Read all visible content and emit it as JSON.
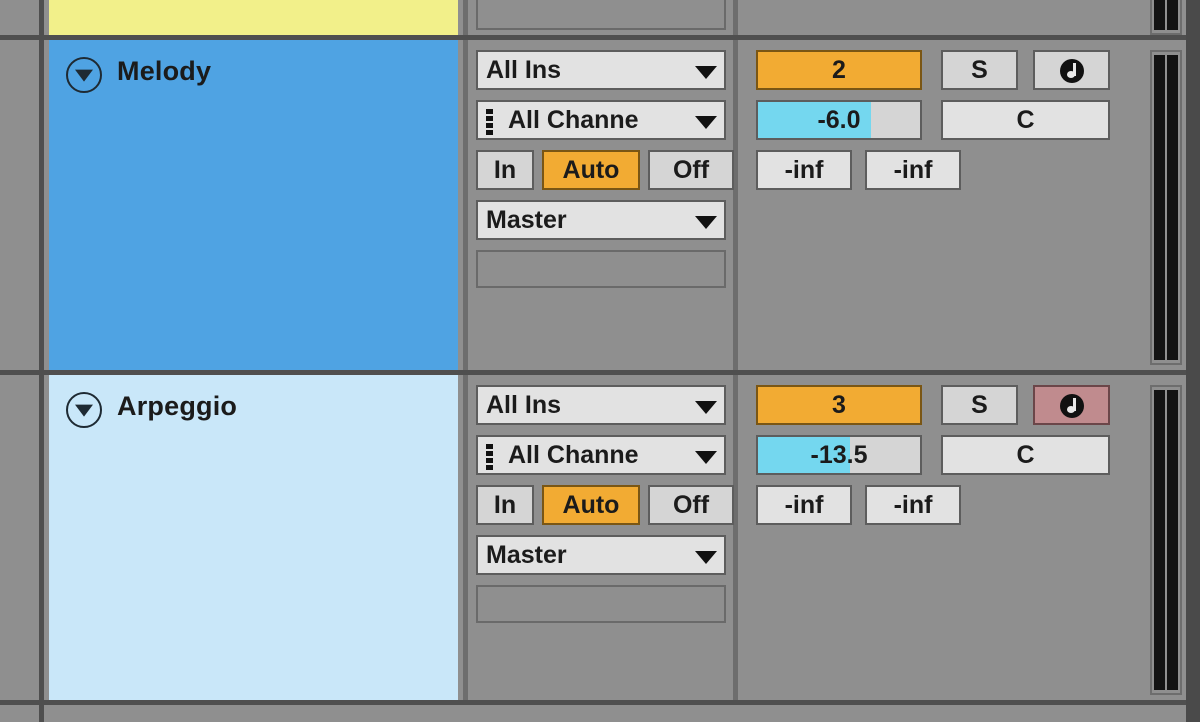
{
  "window": {
    "title": "Ableton Live - Session View Track Headers"
  },
  "tracks": [
    {
      "name": "",
      "color": "#f2f08a",
      "partial": true,
      "io": {
        "empty_slot": true
      }
    },
    {
      "name": "Melody",
      "color": "#4fa3e3",
      "fold_icon": "chevron-down-circle-icon",
      "io": {
        "input_type": "All Ins",
        "input_channel": "All Channe",
        "monitor": {
          "in": "In",
          "auto": "Auto",
          "off": "Off",
          "selected": "Auto"
        },
        "output_type": "Master",
        "output_channel": ""
      },
      "mixer": {
        "track_number": "2",
        "solo": "S",
        "arm_icon": "record-arm-midi-icon",
        "armed": false,
        "volume": "-6.0",
        "volume_fill_pct": 70,
        "pan": "C",
        "send_a": "-inf",
        "send_b": "-inf"
      }
    },
    {
      "name": "Arpeggio",
      "color": "#c9e7f9",
      "fold_icon": "chevron-down-circle-icon",
      "io": {
        "input_type": "All Ins",
        "input_channel": "All Channe",
        "monitor": {
          "in": "In",
          "auto": "Auto",
          "off": "Off",
          "selected": "Auto"
        },
        "output_type": "Master",
        "output_channel": ""
      },
      "mixer": {
        "track_number": "3",
        "solo": "S",
        "arm_icon": "record-arm-midi-icon",
        "armed": true,
        "volume": "-13.5",
        "volume_fill_pct": 57,
        "pan": "C",
        "send_a": "-inf",
        "send_b": "-inf"
      }
    }
  ],
  "colors": {
    "panel_background": "#8f8f8f",
    "border_dark": "#4f4f4f",
    "accent_orange": "#f2ab33",
    "accent_cyan": "#74d7ef",
    "armed_red": "#c08b8e",
    "control_light": "#e2e2e2"
  }
}
